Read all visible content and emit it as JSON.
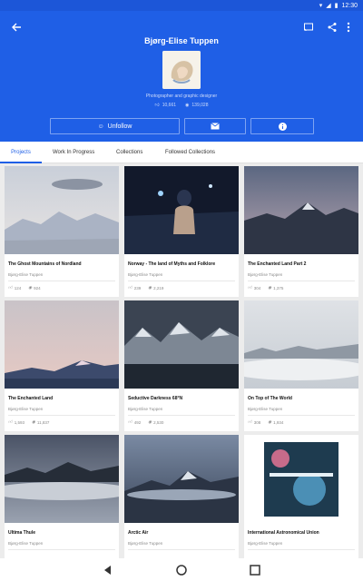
{
  "status": {
    "time": "12:30"
  },
  "header": {
    "name": "Bjørg-Elise Tuppen",
    "description": "Photographer and graphic designer",
    "appreciations": "10,661",
    "views": "139,028"
  },
  "actions": {
    "unfollow_label": "Unfollow"
  },
  "tabs": [
    {
      "label": "Projects"
    },
    {
      "label": "Work In Progress"
    },
    {
      "label": "Collections"
    },
    {
      "label": "Followed Collections"
    }
  ],
  "projects": [
    {
      "title": "The Ghost Mountains of Nordland",
      "owner": "Bjørg-Elise Tuppen",
      "likes": "124",
      "views": "924"
    },
    {
      "title": "Norway - The land of Myths and Folklore",
      "owner": "Bjørg-Elise Tuppen",
      "likes": "239",
      "views": "2,219"
    },
    {
      "title": "The Enchanted Land Part 2",
      "owner": "Bjørg-Elise Tuppen",
      "likes": "304",
      "views": "1,375"
    },
    {
      "title": "The Enchanted Land",
      "owner": "Bjørg-Elise Tuppen",
      "likes": "1,593",
      "views": "11,837"
    },
    {
      "title": "Seductive Darkness 68°N",
      "owner": "Bjørg-Elise Tuppen",
      "likes": "492",
      "views": "2,530"
    },
    {
      "title": "On Top of The World",
      "owner": "Bjørg-Elise Tuppen",
      "likes": "308",
      "views": "1,934"
    },
    {
      "title": "Ultima Thule",
      "owner": "Bjørg-Elise Tuppen",
      "likes": "",
      "views": ""
    },
    {
      "title": "Arctic Air",
      "owner": "Bjørg-Elise Tuppen",
      "likes": "",
      "views": ""
    },
    {
      "title": "International Astronomical Union",
      "owner": "Bjørg-Elise Tuppen",
      "likes": "",
      "views": ""
    }
  ],
  "colors": {
    "header": "#1f5fe6",
    "tab_active": "#1f5fe6"
  }
}
